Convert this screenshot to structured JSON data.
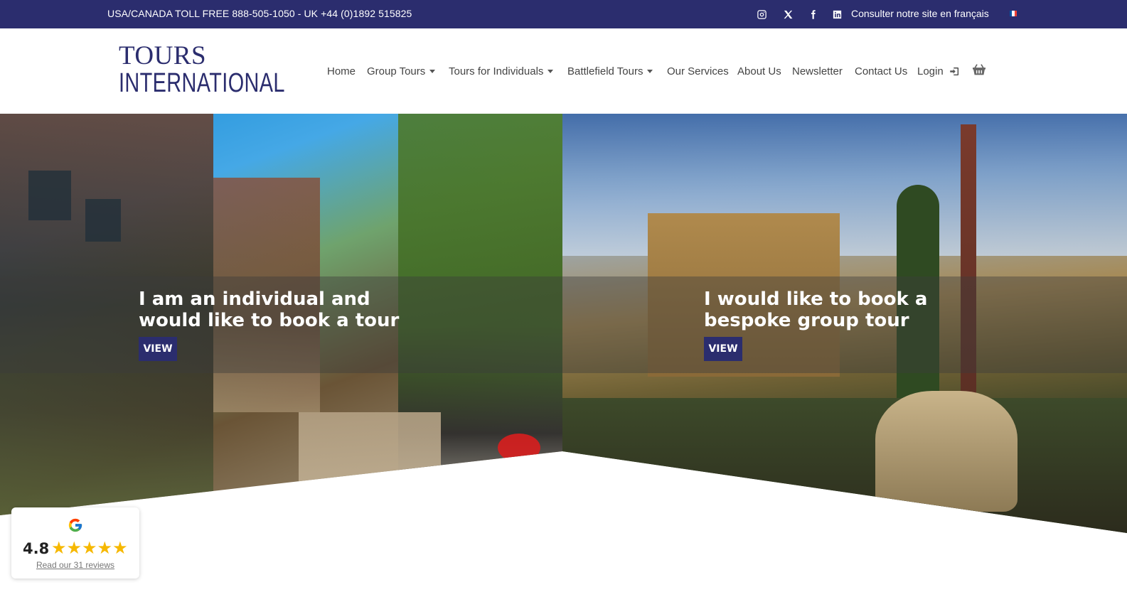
{
  "topbar": {
    "phone": "USA/CANADA TOLL FREE 888-505-1050 - UK +44 (0)1892 515825",
    "social": [
      "instagram-icon",
      "x-icon",
      "facebook-icon",
      "linkedin-icon"
    ],
    "fr_link": "Consulter notre site en français",
    "flag_colors": [
      "#0055a4",
      "#ffffff",
      "#ef4135"
    ],
    "bg": "#2b2d6e"
  },
  "logo": {
    "line1": "TOURS",
    "line2": "INTERNATIONAL"
  },
  "nav": {
    "items": [
      {
        "label": "Home",
        "dropdown": false
      },
      {
        "label": "Group Tours",
        "dropdown": true
      },
      {
        "label": "Tours for Individuals",
        "dropdown": true
      },
      {
        "label": "Battlefield Tours",
        "dropdown": true
      },
      {
        "label": "Our Services",
        "dropdown": false
      },
      {
        "label": "About Us",
        "dropdown": false
      },
      {
        "label": "Newsletter",
        "dropdown": false
      },
      {
        "label": "Contact Us",
        "dropdown": false
      },
      {
        "label": "Login",
        "dropdown": false
      }
    ]
  },
  "hero": {
    "left": {
      "title": "I am an individual and would like to book a tour",
      "button": "VIEW"
    },
    "right": {
      "title": "I would like to book a bespoke group tour",
      "button": "VIEW"
    }
  },
  "review": {
    "score": "4.8",
    "stars": 5,
    "link": "Read our 31 reviews"
  }
}
